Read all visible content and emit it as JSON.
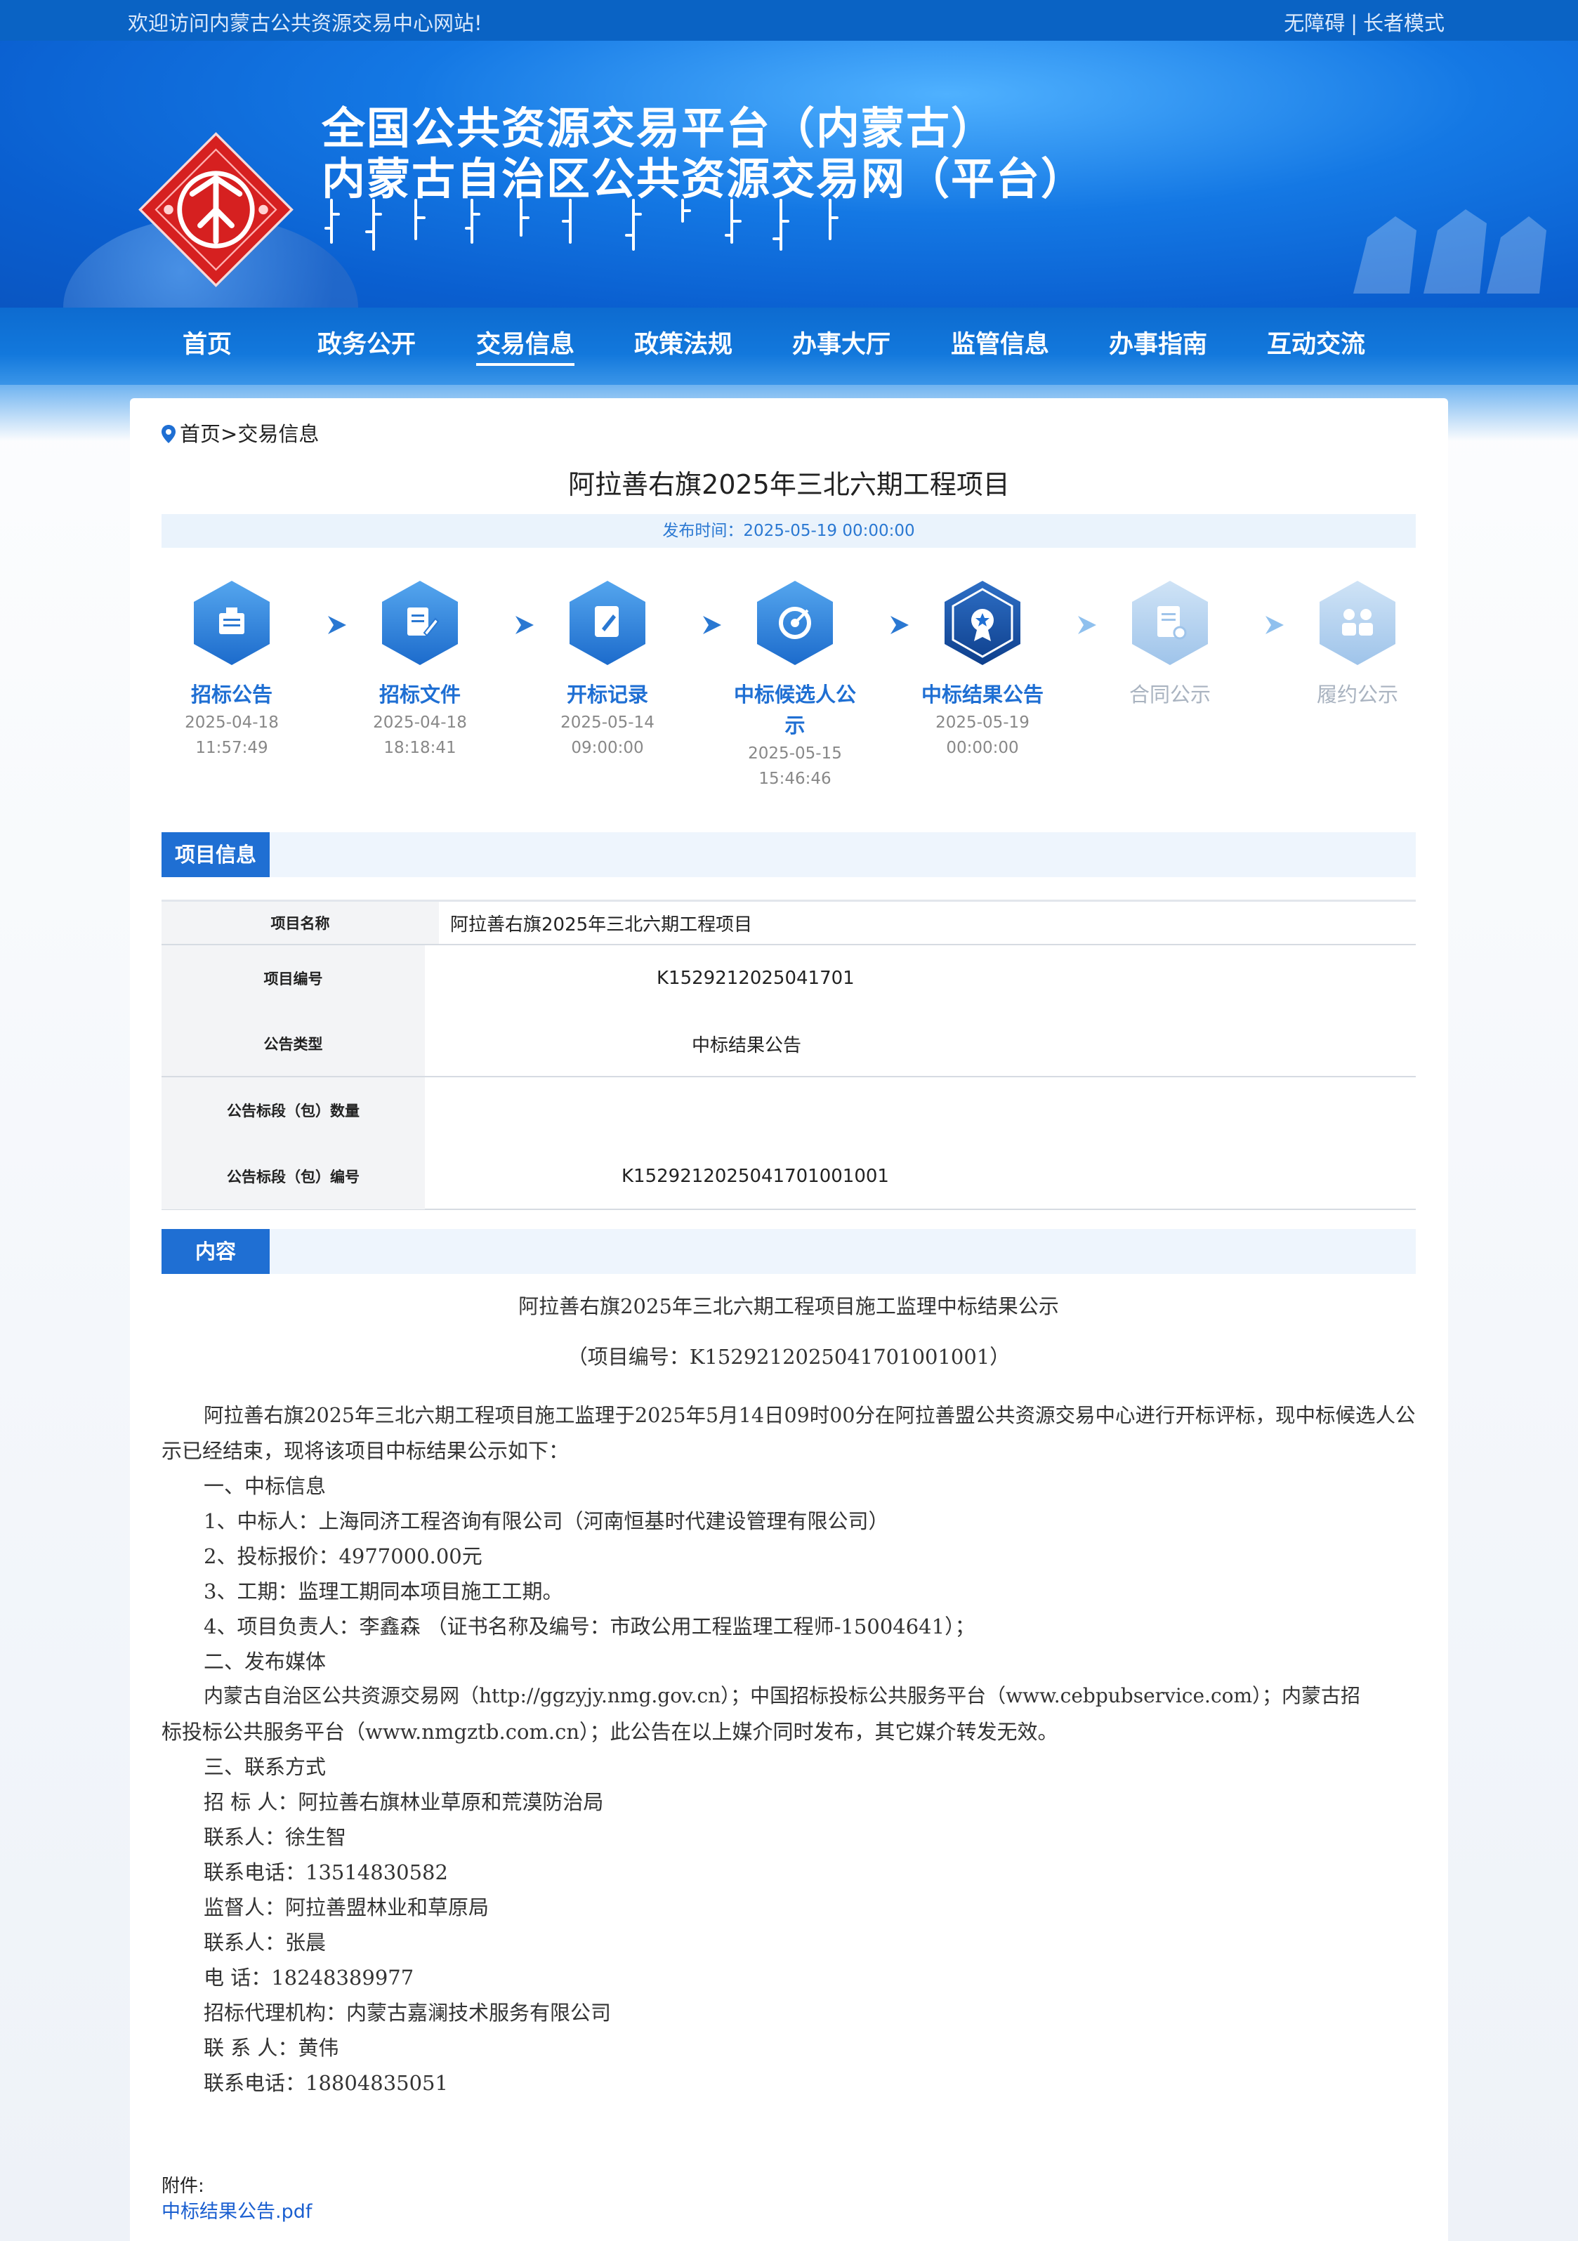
{
  "topbar": {
    "welcome": "欢迎访问内蒙古公共资源交易中心网站!",
    "accessibility": "无障碍",
    "separator": "|",
    "elder_mode": "长者模式"
  },
  "banner": {
    "title_line1": "全国公共资源交易平台（内蒙古）",
    "title_line2": "内蒙古自治区公共资源交易网（平台）"
  },
  "nav": {
    "items": [
      "首页",
      "政务公开",
      "交易信息",
      "政策法规",
      "办事大厅",
      "监管信息",
      "办事指南",
      "互动交流"
    ],
    "active": "交易信息"
  },
  "breadcrumb": {
    "home": "首页",
    "sep": ">",
    "current": "交易信息"
  },
  "page": {
    "title": "阿拉善右旗2025年三北六期工程项目",
    "publish_time": "发布时间：2025-05-19 00:00:00"
  },
  "steps": [
    {
      "name": "招标公告",
      "date": "2025-04-18",
      "time": "11:57:49",
      "state": "done",
      "icon": "announcement-icon"
    },
    {
      "name": "招标文件",
      "date": "2025-04-18",
      "time": "18:18:41",
      "state": "done",
      "icon": "document-edit-icon"
    },
    {
      "name": "开标记录",
      "date": "2025-05-14",
      "time": "09:00:00",
      "state": "done",
      "icon": "record-pen-icon"
    },
    {
      "name": "中标候选人公",
      "name2": "示",
      "date": "2025-05-15",
      "time": "15:46:46",
      "state": "done",
      "icon": "target-icon"
    },
    {
      "name": "中标结果公告",
      "date": "2025-05-19",
      "time": "00:00:00",
      "state": "current",
      "icon": "award-icon"
    },
    {
      "name": "合同公示",
      "date": "",
      "time": "",
      "state": "pending",
      "icon": "contract-icon"
    },
    {
      "name": "履约公示",
      "date": "",
      "time": "",
      "state": "pending",
      "icon": "people-icon"
    }
  ],
  "project_info": {
    "section_label": "项目信息",
    "rows": [
      {
        "label": "项目名称",
        "value": "阿拉善右旗2025年三北六期工程项目"
      },
      {
        "label": "项目编号",
        "value": "K1529212025041701"
      },
      {
        "label": "公告类型",
        "value": "中标结果公告"
      },
      {
        "label": "公告标段（包）数量",
        "value": ""
      },
      {
        "label": "公告标段（包）编号",
        "value": "K1529212025041701001001"
      }
    ]
  },
  "content": {
    "section_label": "内容",
    "heading": "阿拉善右旗2025年三北六期工程项目施工监理中标结果公示",
    "subheading": "（项目编号：K1529212025041701001001）",
    "paragraph1_line1": "阿拉善右旗2025年三北六期工程项目施工监理于2025年5月14日09时00分在阿拉善盟公共资源交易中心进行开标评标，现中标候选人公",
    "paragraph1_line2": "示已经结束，现将该项目中标结果公示如下：",
    "s1": "一、中标信息",
    "s1_1": "1、中标人：上海同济工程咨询有限公司（河南恒基时代建设管理有限公司）",
    "s1_2": "2、投标报价：4977000.00元",
    "s1_3": "3、工期：监理工期同本项目施工工期。",
    "s1_4": "4、项目负责人：李鑫森   （证书名称及编号：市政公用工程监理工程师-15004641）；",
    "s2": "二、发布媒体",
    "s2_line1": "内蒙古自治区公共资源交易网（http://ggzyjy.nmg.gov.cn）；中国招标投标公共服务平台（www.cebpubservice.com）；内蒙古招",
    "s2_line2": "标投标公共服务平台（www.nmgztb.com.cn）；此公告在以上媒介同时发布，其它媒介转发无效。",
    "s3": "三、联系方式",
    "c1": "招  标  人：阿拉善右旗林业草原和荒漠防治局",
    "c2": "联系人：徐生智",
    "c3": "联系电话：13514830582",
    "c4": "监督人：阿拉善盟林业和草原局",
    "c5": "联系人：张晨",
    "c6": "电      话：18248389977",
    "c7": "招标代理机构：内蒙古嘉澜技术服务有限公司",
    "c8": "联  系  人：黄伟",
    "c9": "联系电话：18804835051"
  },
  "attachment": {
    "label": "附件:",
    "file": "中标结果公告.pdf"
  },
  "colors": {
    "brand_blue": "#1f6fd3",
    "topbar": "#0a63c4",
    "pending_gray": "#a9b3c0",
    "link": "#1a5fd0"
  }
}
